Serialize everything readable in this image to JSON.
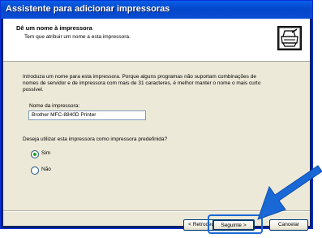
{
  "window": {
    "title": "Assistente para adicionar impressoras"
  },
  "header": {
    "title": "Dê um nome à impressora",
    "subtitle": "Tem que atribuir um nome a esta impressora.",
    "icon": "printer-icon"
  },
  "body": {
    "instructions": "Introduza um nome para esta impressora. Porque alguns programas não suportam combinações de nomes de servidor e de impressora com mais de 31 caracteres, é melhor manter o nome o mais curto possível.",
    "name_label": "Nome da impressora:",
    "name_value": "Brother MFC-8840D Printer",
    "default_question": "Deseja utilizar esta impressora como impressora predefinida?",
    "options": [
      {
        "label": "Sim",
        "selected": true
      },
      {
        "label": "Não",
        "selected": false
      }
    ]
  },
  "buttons": {
    "back": "< Retroceder",
    "next": "Seguinte >",
    "cancel": "Cancelar"
  },
  "annotation": {
    "highlight_color": "#1a68d6",
    "arrow_color": "#1a68d6"
  }
}
